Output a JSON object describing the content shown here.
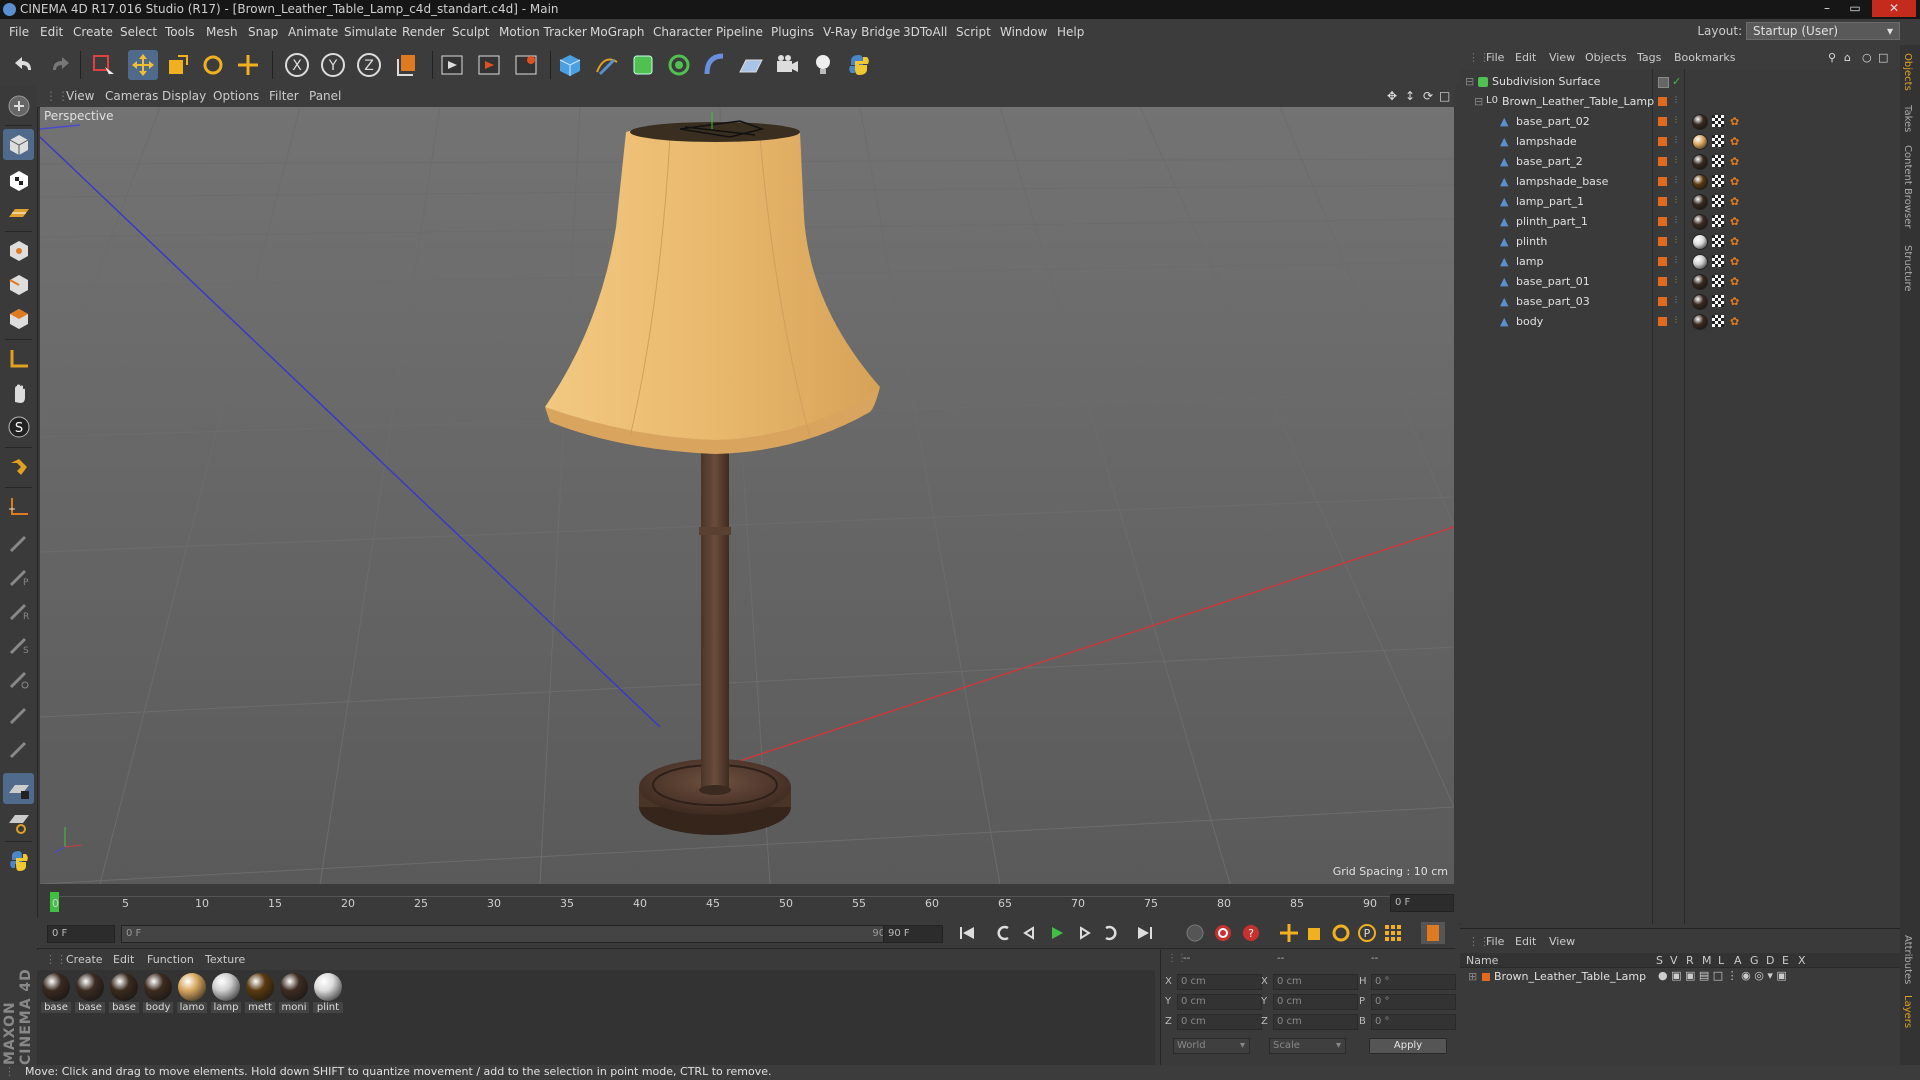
{
  "window": {
    "title": "CINEMA 4D R17.016 Studio (R17) - [Brown_Leather_Table_Lamp_c4d_standart.c4d] - Main"
  },
  "menubar": [
    "File",
    "Edit",
    "Create",
    "Select",
    "Tools",
    "Mesh",
    "Snap",
    "Animate",
    "Simulate",
    "Render",
    "Sculpt",
    "Motion Tracker",
    "MoGraph",
    "Character",
    "Pipeline",
    "Plugins",
    "V-Ray Bridge",
    "3DToAll",
    "Script",
    "Window",
    "Help"
  ],
  "layout": {
    "label": "Layout:",
    "value": "Startup (User)"
  },
  "viewport": {
    "menu": [
      "View",
      "Cameras",
      "Display",
      "Options",
      "Filter",
      "Panel"
    ],
    "label": "Perspective",
    "grid_spacing": "Grid Spacing : 10 cm"
  },
  "timeline": {
    "ticks": [
      "0",
      "5",
      "10",
      "15",
      "20",
      "25",
      "30",
      "35",
      "40",
      "45",
      "50",
      "55",
      "60",
      "65",
      "70",
      "75",
      "80",
      "85",
      "90"
    ],
    "current_frame": "0 F",
    "start_field": "0 F",
    "range_start": "0 F",
    "range_end": "90 F",
    "end_field": "90 F",
    "frame_field": "0 F"
  },
  "materials": {
    "menu": [
      "Create",
      "Edit",
      "Function",
      "Texture"
    ],
    "items": [
      {
        "label": "base",
        "color": "#3a2a20"
      },
      {
        "label": "base",
        "color": "#3b2b22"
      },
      {
        "label": "base",
        "color": "#3a2a1e"
      },
      {
        "label": "body",
        "color": "#3d2b1f"
      },
      {
        "label": "lamo",
        "color": "#d8a860"
      },
      {
        "label": "lamp",
        "color": "#cfcfcf"
      },
      {
        "label": "mett",
        "color": "#5a3a10"
      },
      {
        "label": "moni",
        "color": "#3d2c22"
      },
      {
        "label": "plint",
        "color": "#dcdcdc"
      }
    ]
  },
  "coords": {
    "header": [
      "--",
      "--",
      "--"
    ],
    "rows": [
      {
        "a": "X",
        "v1": "0 cm",
        "b": "X",
        "v2": "0 cm",
        "c": "H",
        "v3": "0 °"
      },
      {
        "a": "Y",
        "v1": "0 cm",
        "b": "Y",
        "v2": "0 cm",
        "c": "P",
        "v3": "0 °"
      },
      {
        "a": "Z",
        "v1": "0 cm",
        "b": "Z",
        "v2": "0 cm",
        "c": "B",
        "v3": "0 °"
      }
    ],
    "world": "World",
    "scale": "Scale",
    "apply": "Apply"
  },
  "objects": {
    "menu": [
      "File",
      "Edit",
      "View",
      "Objects",
      "Tags",
      "Bookmarks"
    ],
    "root": "Subdivision Surface",
    "group": "Brown_Leather_Table_Lamp",
    "children": [
      {
        "name": "base_part_02",
        "mat": "#3a2a20"
      },
      {
        "name": "lampshade",
        "mat": "#d8a860"
      },
      {
        "name": "base_part_2",
        "mat": "#3a2a20"
      },
      {
        "name": "lampshade_base",
        "mat": "#5a3a10"
      },
      {
        "name": "lamp_part_1",
        "mat": "#3a2a20"
      },
      {
        "name": "plinth_part_1",
        "mat": "#3d2c22"
      },
      {
        "name": "plinth",
        "mat": "#dcdcdc"
      },
      {
        "name": "lamp",
        "mat": "#cfcfcf"
      },
      {
        "name": "base_part_01",
        "mat": "#3a2a20"
      },
      {
        "name": "base_part_03",
        "mat": "#3a2a20"
      },
      {
        "name": "body",
        "mat": "#3d2b1f"
      }
    ]
  },
  "attributes": {
    "menu": [
      "File",
      "Edit",
      "View"
    ],
    "columns": [
      "Name",
      "S",
      "V",
      "R",
      "M",
      "L",
      "A",
      "G",
      "D",
      "E",
      "X"
    ],
    "row": "Brown_Leather_Table_Lamp"
  },
  "right_tabs": [
    "Objects",
    "Takes",
    "Content Browser",
    "Structure",
    "Attributes",
    "Layers"
  ],
  "status": "Move: Click and drag to move elements. Hold down SHIFT to quantize movement / add to the selection in point mode, CTRL to remove.",
  "brand": "MAXON CINEMA 4D",
  "colors": {
    "accent": "#e06a20",
    "bg": "#3a3a3a",
    "viewport": "#5f5f5f"
  }
}
